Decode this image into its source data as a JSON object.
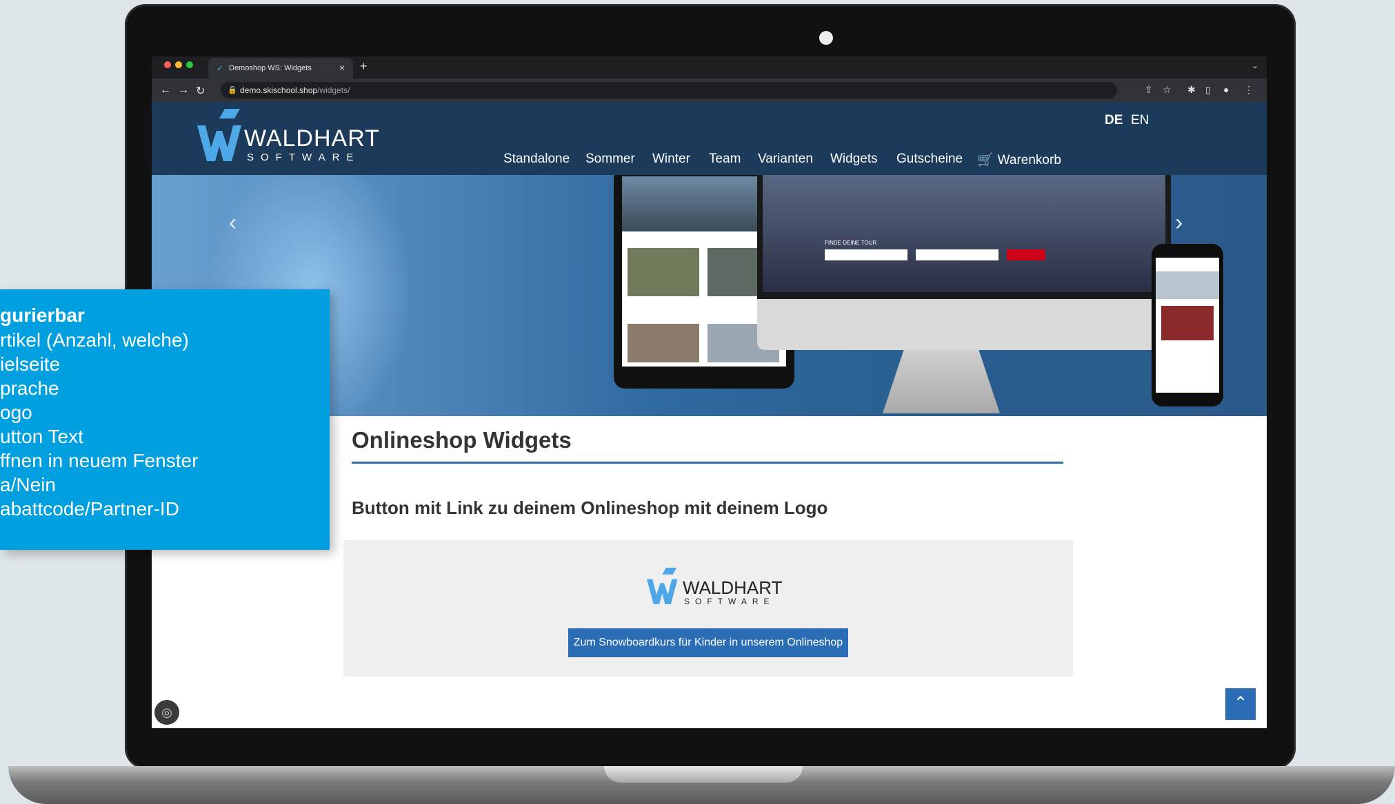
{
  "browser": {
    "tab_title": "Demoshop WS: Widgets",
    "tab_close": "×",
    "new_tab": "+",
    "url_host": "demo.skischool.shop",
    "url_path": "/widgets/"
  },
  "site": {
    "logo_word": "WALDHART",
    "logo_sub": "SOFTWARE",
    "languages": [
      "DE",
      "EN"
    ],
    "nav": [
      "Standalone",
      "Sommer",
      "Winter",
      "Team",
      "Varianten",
      "Widgets",
      "Gutscheine",
      "Warenkorb"
    ]
  },
  "hero": {
    "form_label": "FINDE DEINE TOUR"
  },
  "main": {
    "title": "Onlineshop Widgets",
    "subtitle": "Button mit Link zu deinem Onlineshop mit deinem Logo",
    "widget": {
      "logo_word": "WALDHART",
      "logo_sub": "SOFTWARE",
      "button_label": "Zum Snowboardkurs für Kinder in unserem Onlineshop"
    }
  },
  "overlay": {
    "heading": "gurierbar",
    "items": [
      "rtikel (Anzahl, welche)",
      "ielseite",
      "prache",
      "ogo",
      "utton Text",
      "ffnen in neuem Fenster",
      "a/Nein",
      "abattcode/Partner-ID"
    ]
  },
  "colors": {
    "header_bg": "#1c3b5b",
    "accent_blue": "#2a6db5",
    "overlay_cyan": "#009fdf"
  }
}
